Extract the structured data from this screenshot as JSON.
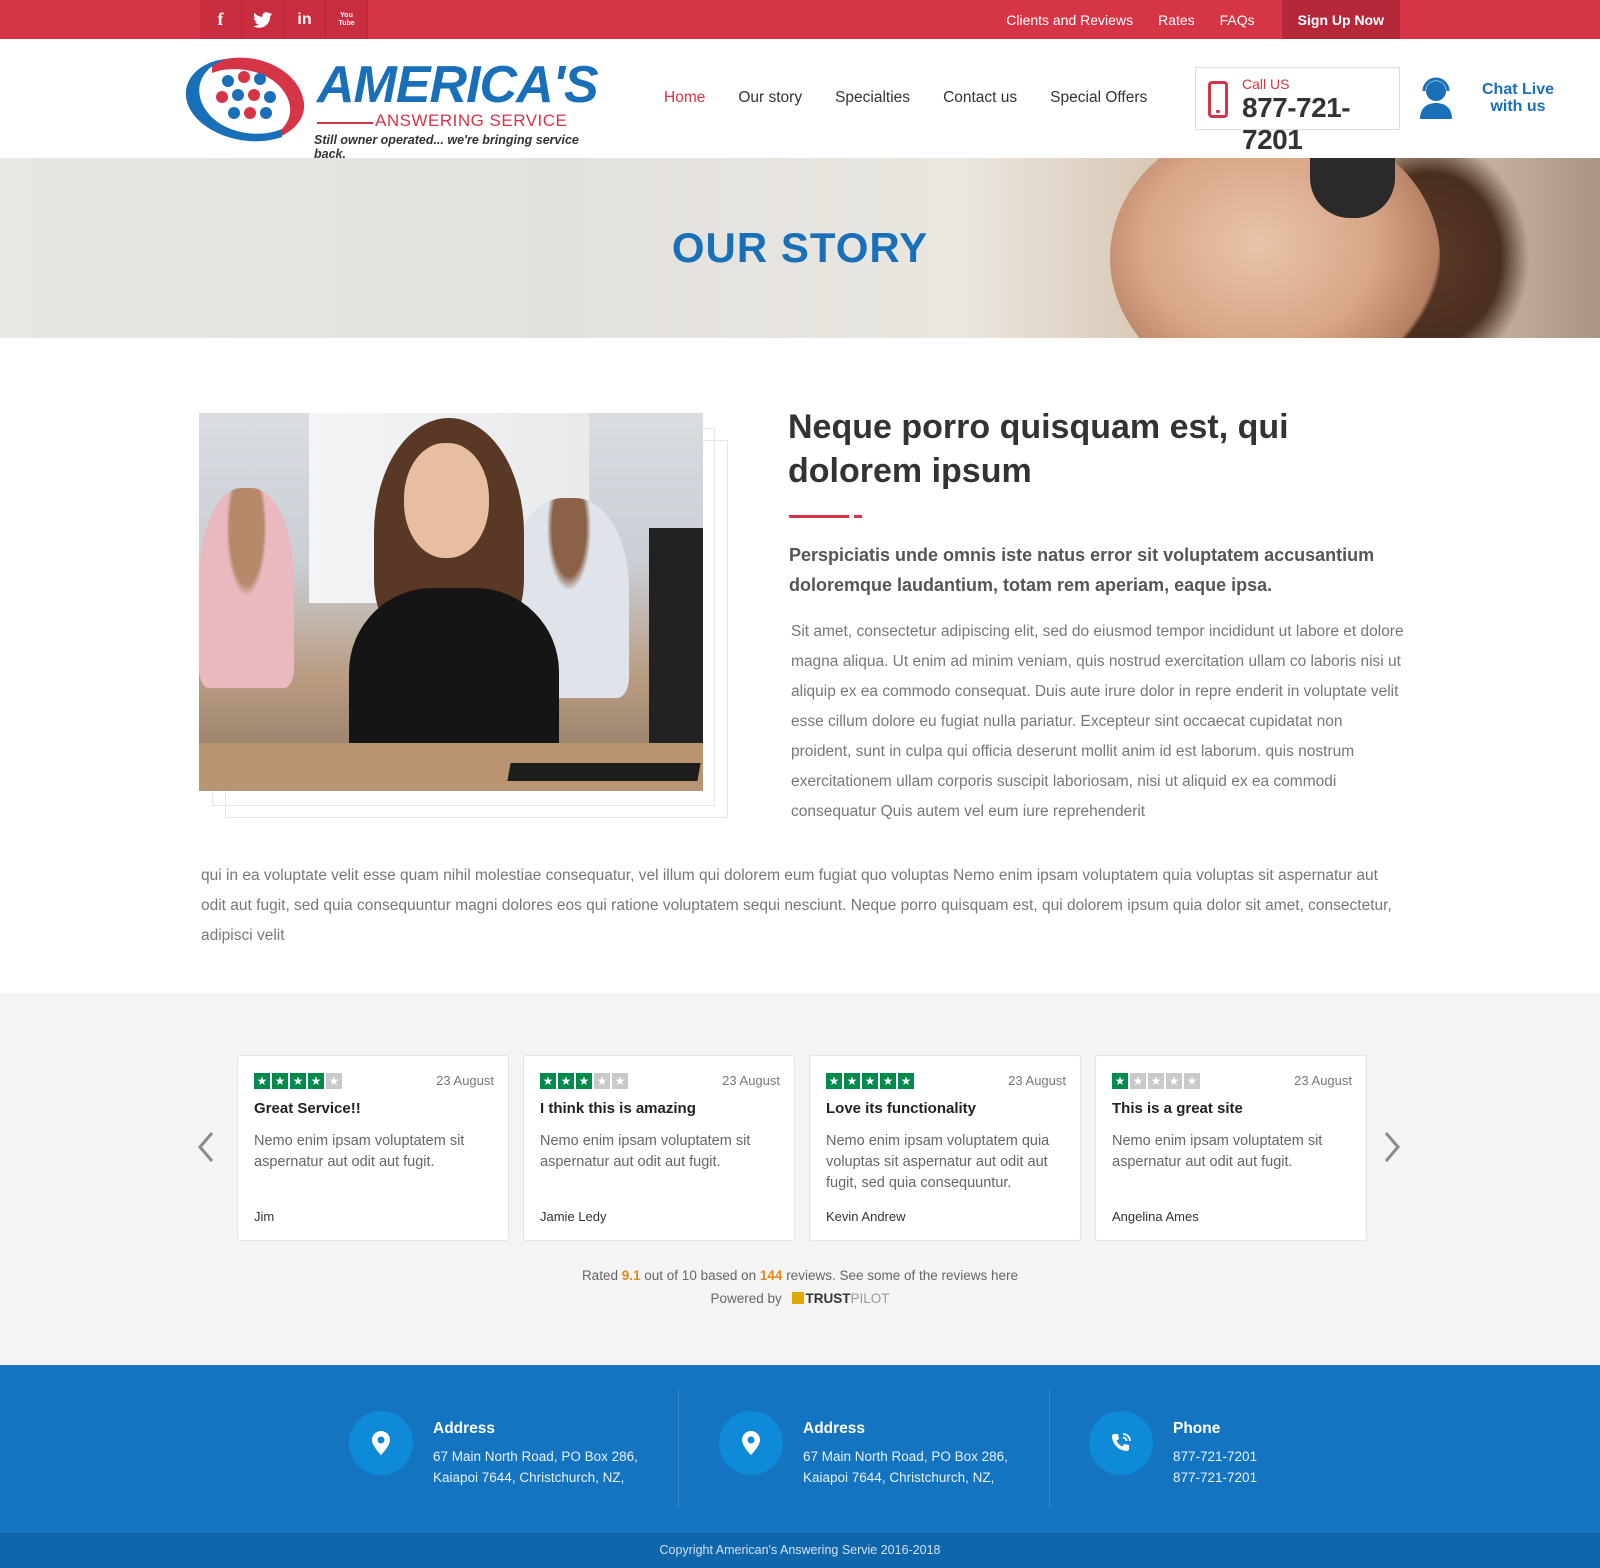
{
  "topbar": {
    "social": [
      {
        "icon": "facebook-icon",
        "glyph": "f"
      },
      {
        "icon": "twitter-icon",
        "glyph": "t"
      },
      {
        "icon": "linkedin-icon",
        "glyph": "in"
      },
      {
        "icon": "youtube-icon",
        "glyph": "You Tube"
      }
    ],
    "links": [
      "Clients and Reviews",
      "Rates",
      "FAQs"
    ],
    "signup": "Sign Up Now"
  },
  "header": {
    "logo_main": "AMERICA'S",
    "logo_sub": "ANSWERING SERVICE",
    "logo_tagline": "Still owner operated... we're bringing service back.",
    "nav": [
      "Home",
      "Our story",
      "Specialties",
      "Contact us",
      "Special Offers"
    ],
    "nav_active": "Home",
    "call_label": "Call US",
    "call_number": "877-721-7201",
    "chat_line1": "Chat Live",
    "chat_line2": "with us"
  },
  "hero": {
    "title": "OUR STORY"
  },
  "story": {
    "heading": "Neque porro quisquam est, qui dolorem ipsum",
    "lead": "Perspiciatis unde omnis iste natus error sit voluptatem accusantium doloremque laudantium, totam rem aperiam, eaque ipsa.",
    "para1": "Sit amet, consectetur adipiscing elit, sed do eiusmod tempor incididunt ut labore et dolore magna aliqua. Ut enim ad minim veniam, quis nostrud exercitation ullam co laboris nisi ut aliquip ex ea commodo consequat. Duis aute irure dolor in repre enderit in voluptate velit esse cillum dolore eu fugiat nulla pariatur. Excepteur sint occaecat cupidatat non proident, sunt in culpa qui officia deserunt mollit anim id est laborum. quis nostrum exercitationem ullam corporis suscipit laboriosam, nisi ut aliquid ex ea commodi consequatur Quis autem vel eum iure reprehenderit",
    "para2": "qui in ea voluptate velit esse quam nihil molestiae consequatur, vel illum qui dolorem eum fugiat quo voluptas Nemo enim ipsam voluptatem quia voluptas sit aspernatur aut odit aut fugit, sed quia consequuntur magni dolores eos qui ratione voluptatem sequi nesciunt. Neque porro quisquam est, qui dolorem ipsum quia dolor sit amet, consectetur, adipisci velit"
  },
  "reviews": {
    "cards": [
      {
        "stars": 4,
        "date": "23 August",
        "title": "Great Service!!",
        "body": "Nemo enim ipsam voluptatem sit aspernatur aut odit aut fugit.",
        "author": "Jim"
      },
      {
        "stars": 3,
        "date": "23 August",
        "title": "I think this is amazing",
        "body": "Nemo enim ipsam voluptatem sit aspernatur aut odit aut fugit.",
        "author": "Jamie Ledy"
      },
      {
        "stars": 5,
        "date": "23 August",
        "title": "Love its functionality",
        "body": "Nemo enim ipsam voluptatem quia voluptas sit aspernatur aut odit aut fugit, sed quia consequuntur.",
        "author": "Kevin Andrew"
      },
      {
        "stars": 1,
        "date": "23 August",
        "title": "This is a great site",
        "body": "Nemo enim ipsam voluptatem sit aspernatur aut odit aut fugit.",
        "author": "Angelina Ames"
      }
    ],
    "rated_prefix": "Rated",
    "rating": "9.1",
    "rated_mid": "out of 10 based on",
    "count": "144",
    "rated_suffix": "reviews. See some of the reviews here",
    "powered": "Powered by",
    "brand_a": "TRUST",
    "brand_b": "PILOT"
  },
  "footer": {
    "cols": [
      {
        "icon": "location-pin-icon",
        "title": "Address",
        "line1": "67 Main North Road, PO Box 286,",
        "line2": "Kaiapoi 7644,  Christchurch, NZ,"
      },
      {
        "icon": "location-pin-icon",
        "title": "Address",
        "line1": "67 Main North Road, PO Box 286,",
        "line2": "Kaiapoi 7644,  Christchurch, NZ,"
      },
      {
        "icon": "phone-ringing-icon",
        "title": "Phone",
        "line1": "877-721-7201",
        "line2": "877-721-7201"
      }
    ],
    "copyright": "Copyright American's Answering Servie 2016-2018"
  },
  "colors": {
    "brand_red": "#d63447",
    "brand_blue": "#1a6fb9",
    "footer_blue": "#1574bf",
    "star_green": "#008a4b"
  }
}
